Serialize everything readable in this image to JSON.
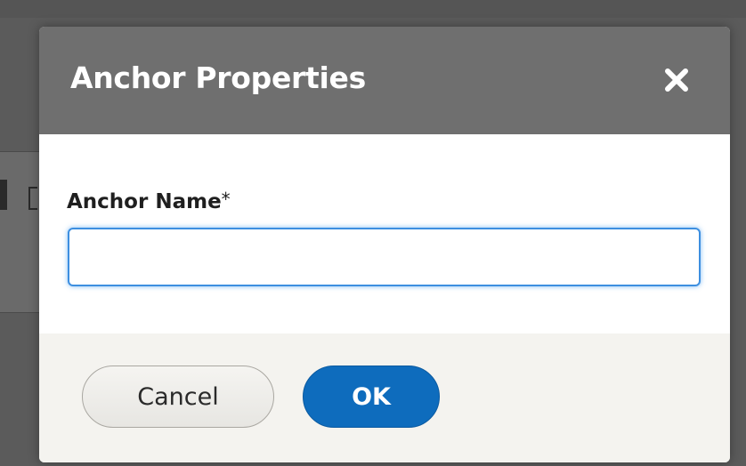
{
  "dialog": {
    "title": "Anchor Properties",
    "close_icon": "close-icon",
    "field": {
      "label": "Anchor Name",
      "required_marker": "*",
      "value": "",
      "placeholder": ""
    },
    "buttons": {
      "cancel_label": "Cancel",
      "ok_label": "OK"
    }
  },
  "colors": {
    "header_bg": "#6f6f6f",
    "ok_button": "#0e6cbd",
    "input_focus": "#3d8fe0",
    "footer_bg": "#f4f3ef"
  }
}
